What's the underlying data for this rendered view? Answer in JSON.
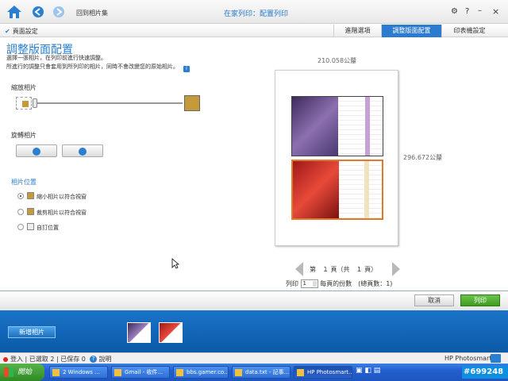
{
  "window": {
    "breadcrumb": "回到相片集",
    "title": "在家列印：配置列印",
    "icons": {
      "home": "home-icon",
      "back": "back-arrow-icon",
      "forward": "forward-arrow-icon",
      "settings": "gear-icon",
      "help": "help-icon",
      "minimize": "minimize-icon",
      "close": "close-icon"
    }
  },
  "tabbar": {
    "page_setup": "頁面設定",
    "tabs": [
      {
        "label": "進階選項",
        "active": false
      },
      {
        "label": "調整版面配置",
        "active": true
      },
      {
        "label": "印表機設定",
        "active": false
      }
    ]
  },
  "left": {
    "heading": "調整版面配置",
    "subtitle": "選擇一張相片，在列印前進行快速調整。",
    "note": "所進行的調整只會套用到所列印的相片，同時不會改變您的原始相片。",
    "info_icon": "i",
    "zoom_label": "縮放相片",
    "zoom_level": 0.0,
    "rotate_label": "旋轉相片",
    "position_label": "相片位置",
    "position_options": [
      {
        "label": "縮小相片以符合視窗",
        "selected": true
      },
      {
        "label": "裁剪相片以符合視窗",
        "selected": false
      },
      {
        "label": "自訂位置",
        "selected": false
      }
    ]
  },
  "preview": {
    "width_dim": "210.058公釐",
    "height_dim": "296.672公釐",
    "pager_text": "第　１ 頁（共　１ 頁）",
    "copies_label": "列印",
    "copies_value": "1",
    "copies_suffix": "每頁的份數　(總頁數：1)"
  },
  "actions": {
    "cancel": "取消",
    "print": "列印"
  },
  "tray": {
    "add_photo": "新增相片"
  },
  "statusbar": {
    "text": "登入 | 已選取 2 | 已保存 0",
    "help": "說明",
    "brand": "HP Photosmart"
  },
  "taskbar": {
    "start": "開始",
    "items": [
      {
        "label": "2 Windows ..."
      },
      {
        "label": "Gmail - 收件..."
      },
      {
        "label": "bbs.gamer.co..."
      },
      {
        "label": "data.txt - 記事..."
      },
      {
        "label": "HP Photosmart..."
      }
    ],
    "clock": "#699248"
  }
}
